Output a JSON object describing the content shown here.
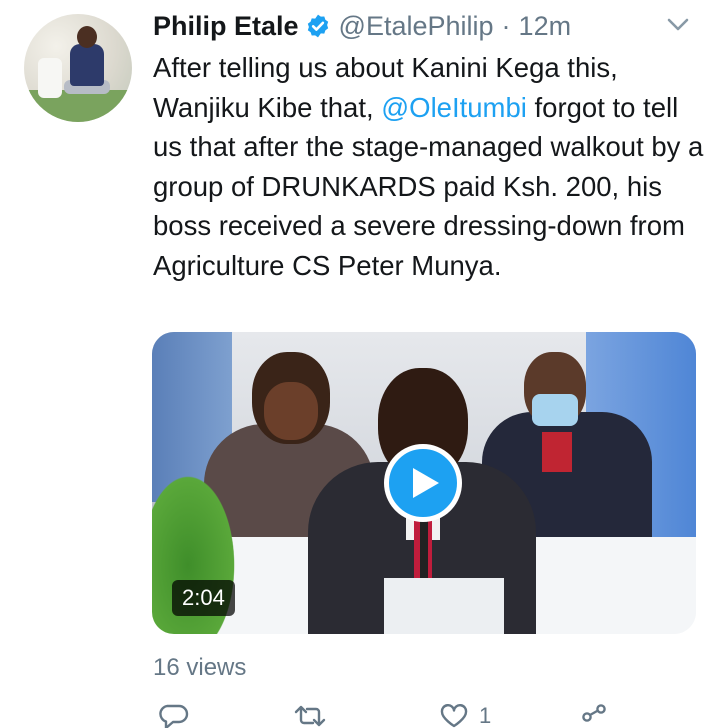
{
  "tweet": {
    "author_name": "Philip Etale",
    "handle": "@EtalePhilip",
    "separator": "·",
    "time": "12m",
    "text_before_mention": "After telling us about Kanini Kega this, Wanjiku Kibe that, ",
    "mention": "@OleItumbi",
    "text_after_mention": " forgot to tell us that after the stage-managed walkout by a group of DRUNKARDS paid Ksh. 200, his boss received a severe dressing-down from Agriculture CS Peter Munya.",
    "video": {
      "duration": "2:04"
    },
    "views": "16 views",
    "like_count": "1"
  },
  "colors": {
    "accent": "#1da1f2",
    "secondary_text": "#657786",
    "primary_text": "#14171a"
  },
  "icons": {
    "verified": "verified-badge-icon",
    "caret": "chevron-down-icon",
    "play": "play-icon",
    "reply": "reply-icon",
    "retweet": "retweet-icon",
    "like": "heart-icon",
    "share": "share-icon"
  }
}
